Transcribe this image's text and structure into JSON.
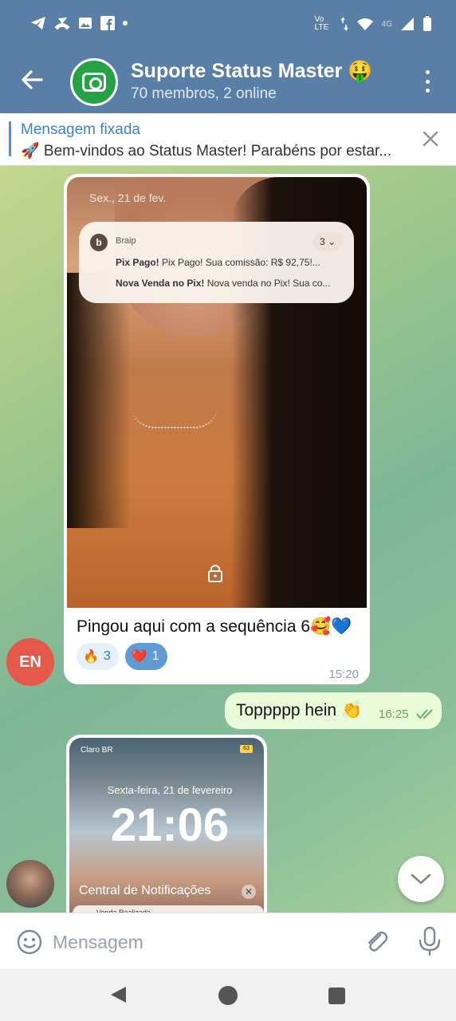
{
  "status_bar": {
    "left_icons": [
      "telegram-icon",
      "missed-call-icon",
      "gallery-icon",
      "facebook-icon",
      "dot-icon"
    ],
    "network": "Vo LTE",
    "signal": "4G",
    "right_icons": [
      "data-arrows-icon",
      "wifi-icon",
      "signal-icon",
      "battery-icon"
    ]
  },
  "header": {
    "title": "Suporte Status Master 🤑",
    "subtitle": "70 membros, 2 online"
  },
  "pinned": {
    "title": "Mensagem fixada",
    "text": "🚀 Bem-vindos ao Status Master!  Parabéns por estar..."
  },
  "messages": {
    "image1": {
      "lock_date": "Sex., 21 de fev.",
      "notification": {
        "app": "Braip",
        "logo": "b",
        "count": "3",
        "line1_bold": "Pix Pago!",
        "line1_text": " Pix Pago! Sua comissão: R$ 92,75!...",
        "line2_bold": "Nova Venda no Pix!",
        "line2_text": " Nova venda no Pix! Sua co..."
      },
      "caption": "Pingou aqui com a sequência 6🥰💙",
      "reactions": [
        {
          "emoji": "🔥",
          "count": "3"
        },
        {
          "emoji": "❤️",
          "count": "1"
        }
      ],
      "time": "15:20",
      "sender_initials": "EN"
    },
    "outgoing": {
      "text": "Toppppp hein 👏",
      "time": "16:25"
    },
    "image2": {
      "carrier": "Claro BR",
      "battery": "63",
      "date": "Sexta-feira, 21 de fevereiro",
      "clock": "21:06",
      "notif_center": "Central de Notificações",
      "card_text": "Venda Realizada"
    }
  },
  "input": {
    "placeholder": "Mensagem"
  },
  "colors": {
    "header": "#5a7fa6",
    "pinned_accent": "#3b84c4",
    "outgoing_bubble": "#e9fbd9",
    "avatar_en": "#e4594a",
    "group_avatar": "#25a244"
  }
}
